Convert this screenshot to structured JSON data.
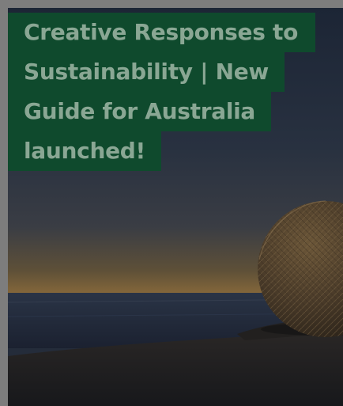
{
  "article_card": {
    "title_lines": [
      "Creative Responses to",
      "Sustainability | New",
      "Guide for Australia",
      "launched!"
    ],
    "image": {
      "description": "sculpture-sphere-at-dusk",
      "colors": {
        "sky_top": "#1e2738",
        "sky_mid": "#3a3f4a",
        "horizon_glow": "#8a6a3c",
        "sea": "#1d2634",
        "ground": "#1a1b1e",
        "sphere": "#4a3a28"
      }
    },
    "overlay_color": "#0f4a2d",
    "title_color": "#8aa794"
  }
}
